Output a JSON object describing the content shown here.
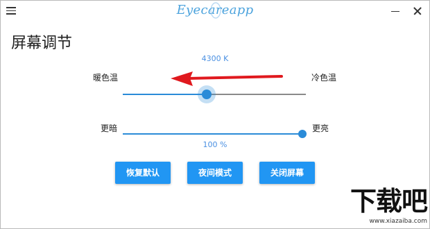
{
  "window": {
    "app_title": "Eyecareapp",
    "menu_icon": "hamburger-menu-icon",
    "minimize_icon": "minimize-icon",
    "close_icon": "close-icon"
  },
  "page": {
    "title": "屏幕调节"
  },
  "color_temperature": {
    "value_text": "4300 K",
    "warm_label": "暖色温",
    "cold_label": "冷色温",
    "level": 0.5
  },
  "brightness": {
    "dark_label": "更暗",
    "bright_label": "更亮",
    "value_text": "100 %",
    "level": 1.0
  },
  "buttons": {
    "restore_default": "恢复默认",
    "night_mode": "夜间模式",
    "close_screen": "关闭屏幕"
  },
  "watermark": {
    "text": "下载吧",
    "url": "www.xiazaiba.com"
  },
  "colors": {
    "accent": "#2196f3",
    "slider_blue": "#2a8bd8",
    "arrow_red": "#e0191e"
  }
}
